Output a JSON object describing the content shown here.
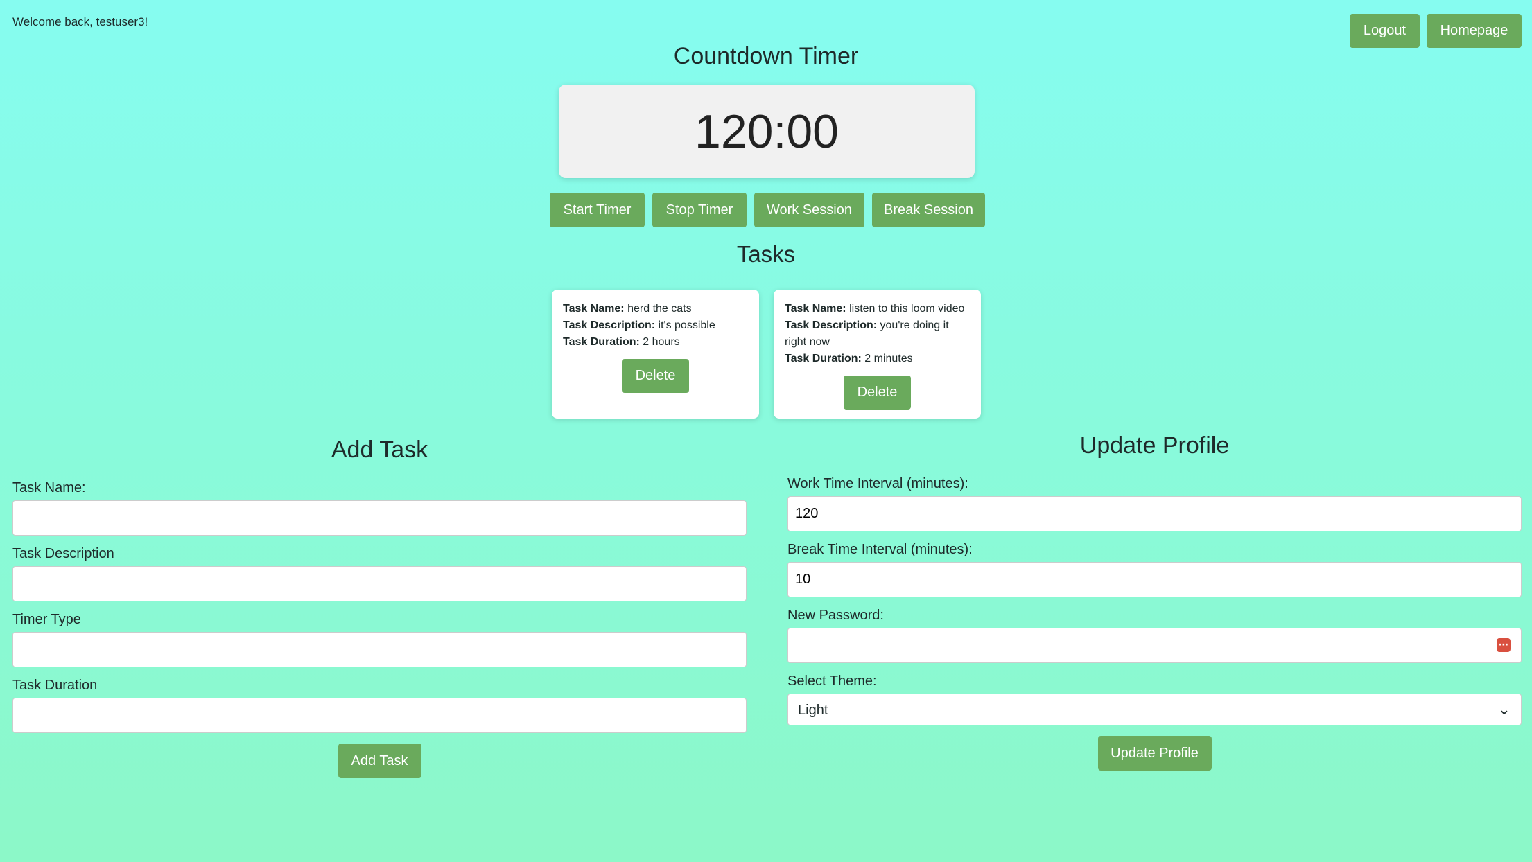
{
  "header": {
    "welcome": "Welcome back, testuser3!",
    "logout": "Logout",
    "homepage": "Homepage"
  },
  "timer": {
    "title": "Countdown Timer",
    "display": "120:00",
    "start": "Start Timer",
    "stop": "Stop Timer",
    "work": "Work Session",
    "break": "Break Session"
  },
  "tasks": {
    "title": "Tasks",
    "name_label": "Task Name:",
    "desc_label": "Task Description:",
    "dur_label": "Task Duration:",
    "delete": "Delete",
    "items": [
      {
        "name": "herd the cats",
        "description": "it's possible",
        "duration": "2 hours"
      },
      {
        "name": "listen to this loom video",
        "description": "you're doing it right now",
        "duration": "2 minutes"
      }
    ]
  },
  "add_task": {
    "title": "Add Task",
    "name_label": "Task Name:",
    "desc_label": "Task Description",
    "type_label": "Timer Type",
    "dur_label": "Task Duration",
    "submit": "Add Task"
  },
  "profile": {
    "title": "Update Profile",
    "work_label": "Work Time Interval (minutes):",
    "work_value": "120",
    "break_label": "Break Time Interval (minutes):",
    "break_value": "10",
    "password_label": "New Password:",
    "theme_label": "Select Theme:",
    "theme_value": "Light",
    "submit": "Update Profile"
  },
  "colors": {
    "accent": "#6aaa5c",
    "bg_top": "#86fcf0",
    "bg_bottom": "#8cf8c8"
  }
}
